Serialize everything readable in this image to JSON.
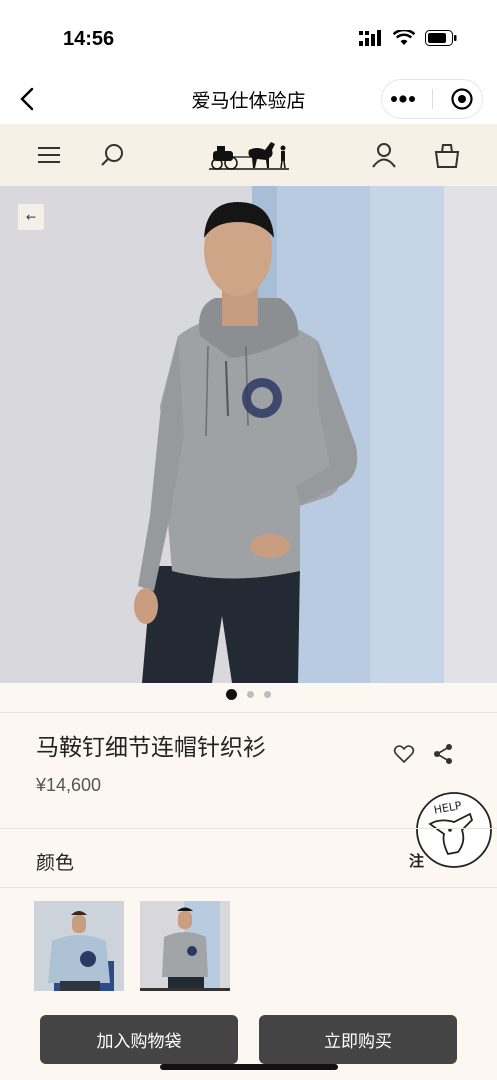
{
  "status_bar": {
    "time": "14:56"
  },
  "navbar": {
    "title": "爱马仕体验店"
  },
  "product": {
    "title": "马鞍钉细节连帽针织衫",
    "price": "¥14,600",
    "image_index": 1,
    "image_count": 3
  },
  "help_badge": {
    "text": "HELP"
  },
  "color_section": {
    "label": "颜色",
    "note": "注"
  },
  "buttons": {
    "add_to_bag": "加入购物袋",
    "buy_now": "立即购买"
  },
  "colors": {
    "header_bg": "#f6f0e6",
    "page_bg": "#fcf7f1",
    "button_bg": "#444444",
    "hero_bg": "#d9d8dc",
    "hero_panel": "#b9cbe0"
  }
}
